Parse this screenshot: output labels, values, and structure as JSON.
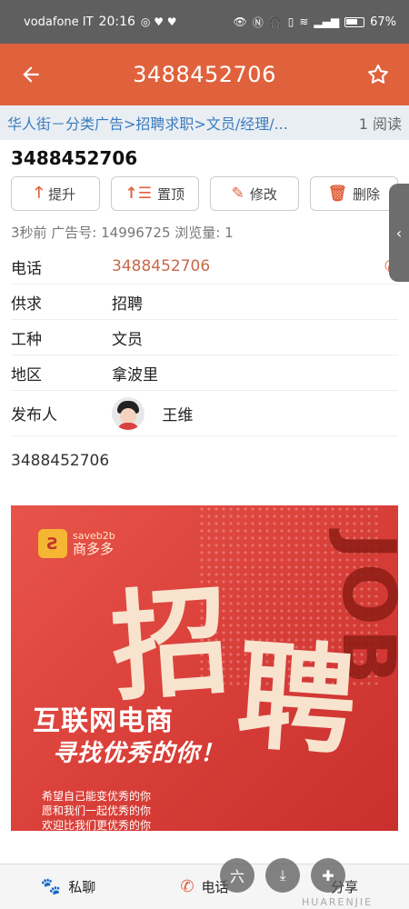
{
  "status_bar": {
    "carrier": "vodafone IT",
    "time": "20:16",
    "battery": "67%"
  },
  "app_bar": {
    "title": "3488452706",
    "back_icon": "arrow-left-icon",
    "star_icon": "star-outline-icon"
  },
  "breadcrumb": {
    "path": "华人街－分类广告>招聘求职>文员/经理/...",
    "reads": "1 阅读"
  },
  "post": {
    "title": "3488452706",
    "meta": "3秒前   广告号: 14996725   浏览量: 1",
    "description": "3488452706"
  },
  "actions": [
    {
      "label": "提升",
      "icon": "arrow-up-icon"
    },
    {
      "label": "置顶",
      "icon": "pin-top-icon"
    },
    {
      "label": "修改",
      "icon": "pencil-icon"
    },
    {
      "label": "删除",
      "icon": "trash-icon"
    }
  ],
  "info": {
    "phone_label": "电话",
    "phone_value": "3488452706",
    "type_label": "供求",
    "type_value": "招聘",
    "job_label": "工种",
    "job_value": "文员",
    "area_label": "地区",
    "area_value": "拿波里",
    "poster_label": "发布人",
    "poster_value": "王维"
  },
  "banner": {
    "logo_en": "saveb2b",
    "logo_cn": "商多多",
    "char1": "招",
    "char2": "聘",
    "job_word": "JOB",
    "headline": "互联网电商",
    "subline": "寻找优秀的你！",
    "small_lines": [
      "希望自己能变优秀的你",
      "愿和我们一起优秀的你",
      "欢迎比我们更优秀的你"
    ]
  },
  "bottom_bar": {
    "chat_label": "私聊",
    "call_label": "电话",
    "share_label": "分享"
  },
  "watermark": "HUARENJIE",
  "colors": {
    "accent": "#e0623d",
    "breadcrumb_bg": "#e9eef3",
    "link": "#3b7bbf"
  }
}
